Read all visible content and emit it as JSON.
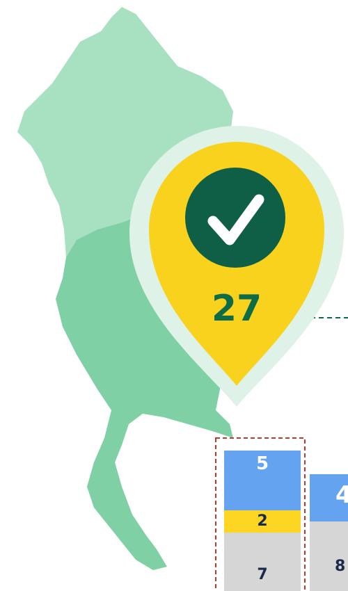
{
  "pin": {
    "count": "27",
    "icon": "checkmark-icon",
    "color_fill": "#f9d21e",
    "color_halo": "#dff2e7",
    "color_badge": "#0f5e46"
  },
  "map": {
    "color_north": "#a8e0c2",
    "color_south": "#7fd0a5"
  },
  "bars": [
    {
      "top": "5",
      "middle": "2",
      "bottom": "7"
    },
    {
      "top": "4",
      "middle": "",
      "bottom": "8"
    }
  ],
  "colors": {
    "bar_blue": "#63a3f0",
    "bar_yellow": "#fdd623",
    "bar_gray": "#d6d6d6",
    "highlight_border": "#c0392b",
    "connector_line": "#0d6b45",
    "label_text": "#ffffff",
    "label_dark": "#1a2a4a"
  }
}
